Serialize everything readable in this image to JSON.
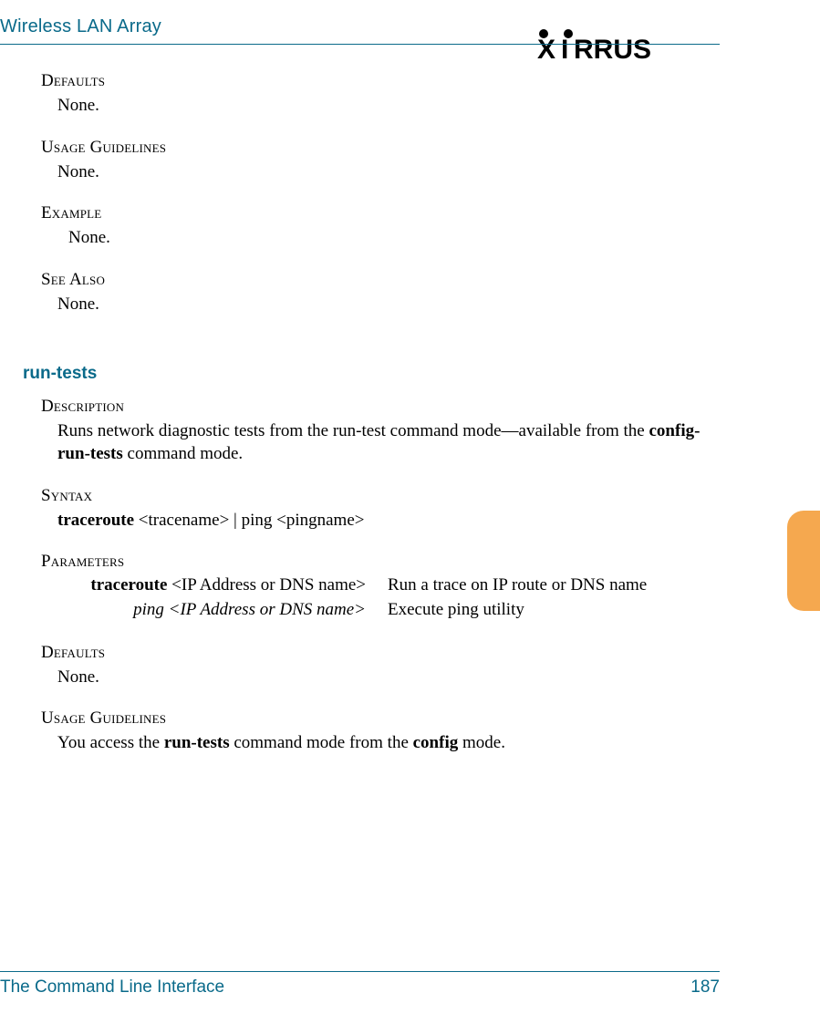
{
  "header": {
    "title": "Wireless LAN Array",
    "brand": "XIRRUS"
  },
  "sections_top": {
    "defaults": {
      "head": "Defaults",
      "body": "None."
    },
    "usage": {
      "head": "Usage Guidelines",
      "body": "None."
    },
    "example": {
      "head": "Example",
      "body": "None."
    },
    "seealso": {
      "head": "See Also",
      "body": "None."
    }
  },
  "cmd": {
    "name": "run-tests"
  },
  "desc": {
    "head": "Description",
    "text1": "Runs network diagnostic tests from the run-test command mode—available from the ",
    "bold1": "config-run-tests",
    "text2": " command mode."
  },
  "syntax": {
    "head": "Syntax",
    "bold": "traceroute",
    "rest": " <tracename> | ping <pingname>"
  },
  "params": {
    "head": "Parameters",
    "row1": {
      "left_bold": "traceroute",
      "left_rest": " <IP Address or DNS name>",
      "right": "Run a trace on IP route or DNS name"
    },
    "row2": {
      "left_ital": "ping <IP Address or DNS name>",
      "right": "Execute ping utility"
    }
  },
  "defaults2": {
    "head": "Defaults",
    "body": "None."
  },
  "usage2": {
    "head": "Usage Guidelines",
    "t1": "You access the ",
    "b1": "run-tests",
    "t2": " command mode from the ",
    "b2": "config",
    "t3": " mode."
  },
  "footer": {
    "left": "The Command Line Interface",
    "right": "187"
  }
}
